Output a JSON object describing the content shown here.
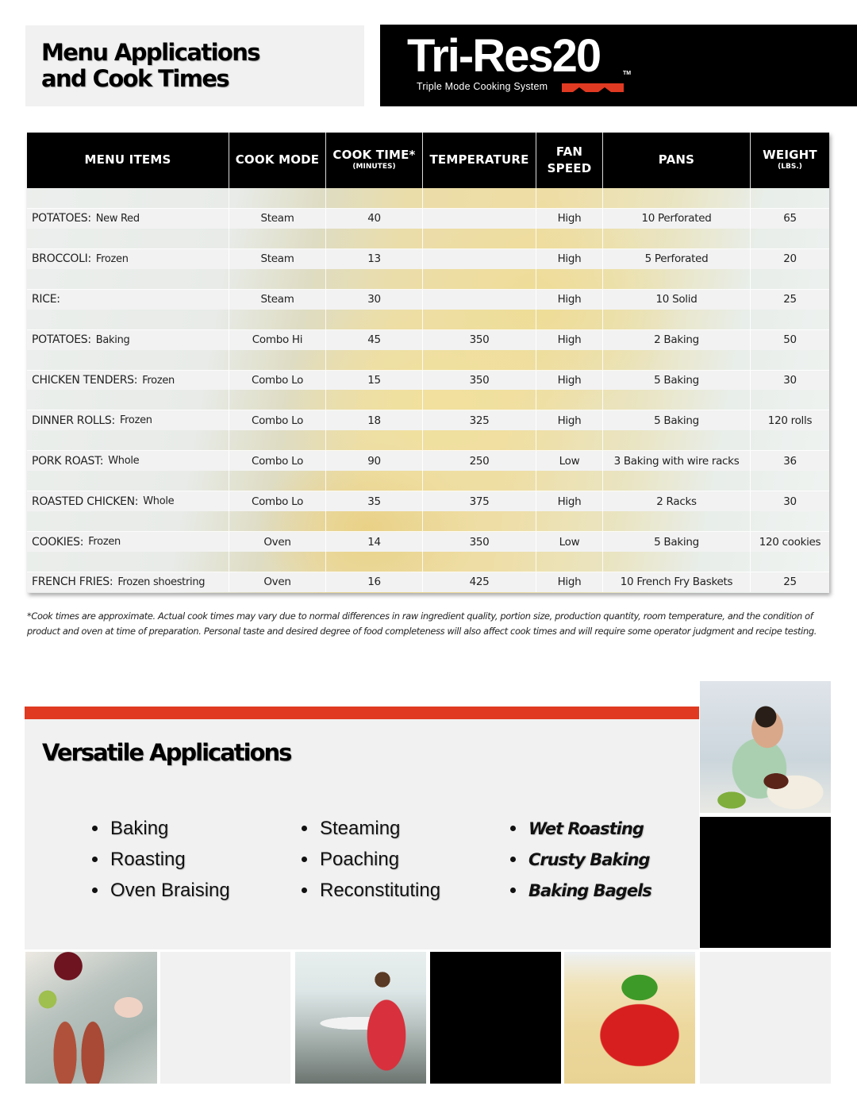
{
  "header": {
    "title_line1": "Menu Applications",
    "title_line2": "and Cook Times",
    "logo": {
      "wordmark": "Tri-Res20",
      "trademark": "TM",
      "tagline": "Triple Mode Cooking System",
      "accent_color": "#e03a22"
    }
  },
  "table": {
    "columns": [
      {
        "label": "MENU ITEMS",
        "sub": ""
      },
      {
        "label": "COOK MODE",
        "sub": ""
      },
      {
        "label": "COOK TIME*",
        "sub": "(MINUTES)"
      },
      {
        "label": "TEMPERATURE",
        "sub": ""
      },
      {
        "label": "FAN",
        "label2": "SPEED",
        "sub": ""
      },
      {
        "label": "PANS",
        "sub": ""
      },
      {
        "label": "WEIGHT",
        "sub": "(LBS.)"
      }
    ],
    "rows": [
      {
        "category": "POTATOES:",
        "detail": "New Red",
        "mode": "Steam",
        "time": "40",
        "temp": "",
        "fan": "High",
        "pans": "10 Perforated",
        "weight": "65"
      },
      {
        "category": "BROCCOLI:",
        "detail": "Frozen",
        "mode": "Steam",
        "time": "13",
        "temp": "",
        "fan": "High",
        "pans": "5 Perforated",
        "weight": "20"
      },
      {
        "category": "RICE:",
        "detail": "",
        "mode": "Steam",
        "time": "30",
        "temp": "",
        "fan": "High",
        "pans": "10 Solid",
        "weight": "25"
      },
      {
        "category": "POTATOES:",
        "detail": "Baking",
        "mode": "Combo Hi",
        "time": "45",
        "temp": "350",
        "fan": "High",
        "pans": "2 Baking",
        "weight": "50"
      },
      {
        "category": "CHICKEN TENDERS:",
        "detail": "Frozen",
        "mode": "Combo Lo",
        "time": "15",
        "temp": "350",
        "fan": "High",
        "pans": "5 Baking",
        "weight": "30"
      },
      {
        "category": "DINNER ROLLS:",
        "detail": "Frozen",
        "mode": "Combo Lo",
        "time": "18",
        "temp": "325",
        "fan": "High",
        "pans": "5 Baking",
        "weight": "120 rolls"
      },
      {
        "category": "PORK ROAST:",
        "detail": "Whole",
        "mode": "Combo Lo",
        "time": "90",
        "temp": "250",
        "fan": "Low",
        "pans": "3 Baking with wire racks",
        "weight": "36"
      },
      {
        "category": "ROASTED CHICKEN:",
        "detail": "Whole",
        "mode": "Combo Lo",
        "time": "35",
        "temp": "375",
        "fan": "High",
        "pans": "2 Racks",
        "weight": "30"
      },
      {
        "category": "COOKIES:",
        "detail": "Frozen",
        "mode": "Oven",
        "time": "14",
        "temp": "350",
        "fan": "Low",
        "pans": "5 Baking",
        "weight": "120 cookies"
      },
      {
        "category": "FRENCH FRIES:",
        "detail": "Frozen shoestring",
        "mode": "Oven",
        "time": "16",
        "temp": "425",
        "fan": "High",
        "pans": "10 French Fry Baskets",
        "weight": "25"
      }
    ]
  },
  "footnote": "*Cook times are approximate.  Actual cook times may vary due to normal differences in raw ingredient quality, portion size, production quantity, room temperature, and the condition of product and oven at time of preparation. Personal taste and desired degree of food completeness will also affect cook times and will require some operator judgment and recipe testing.",
  "versatile": {
    "title": "Versatile Applications",
    "accent_color": "#e03a22",
    "columns": [
      [
        "Baking",
        "Roasting",
        "Oven Braising"
      ],
      [
        "Steaming",
        "Poaching",
        "Reconstituting"
      ],
      [
        "Wet Roasting",
        "Crusty Baking",
        "Baking Bagels"
      ]
    ]
  },
  "photos": [
    {
      "id": "child-eating-hospital-tray",
      "description": "Boy eating from a meal tray"
    },
    {
      "id": "school-lunch-tray",
      "description": "Lunch tray with hot dogs, apple, grapes"
    },
    {
      "id": "school-cafeteria",
      "description": "Students in cafeteria"
    },
    {
      "id": "spaghetti-marinara",
      "description": "Spaghetti with tomato sauce and basil"
    }
  ]
}
